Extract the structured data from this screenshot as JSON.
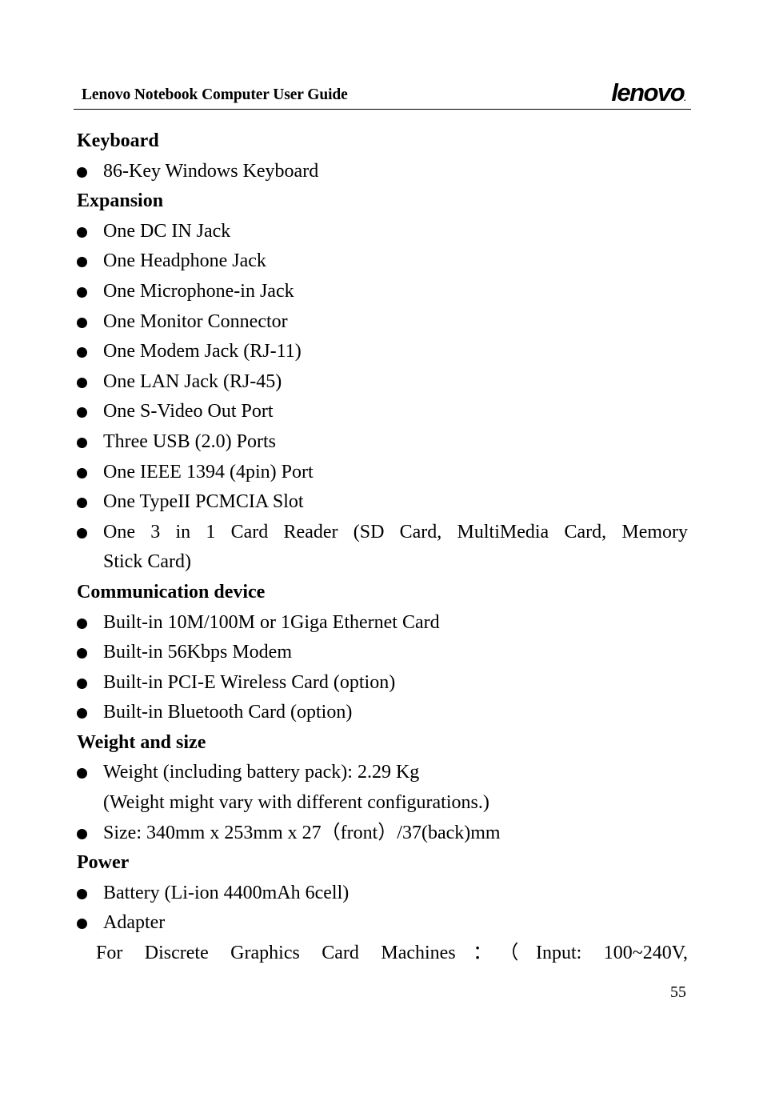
{
  "header": {
    "title": "Lenovo Notebook Computer User Guide",
    "logo_text": "lenovo",
    "logo_dot": "."
  },
  "sections": [
    {
      "heading": "Keyboard",
      "items": [
        "86-Key Windows Keyboard"
      ]
    },
    {
      "heading": "Expansion",
      "items": [
        "One DC IN Jack",
        "One Headphone Jack",
        "One Microphone-in Jack",
        "One Monitor Connector",
        "One Modem Jack (RJ-11)",
        "One LAN Jack (RJ-45)",
        "One S-Video Out Port",
        "Three USB (2.0) Ports",
        "One IEEE 1394 (4pin) Port",
        "One TypeII PCMCIA Slot"
      ],
      "wrapped_item": {
        "line1": "One 3 in 1 Card Reader (SD Card, MultiMedia Card, Memory",
        "line2": "Stick Card)"
      }
    },
    {
      "heading": "Communication device",
      "items": [
        "Built-in 10M/100M or 1Giga Ethernet Card",
        "Built-in 56Kbps Modem",
        "Built-in PCI-E Wireless Card (option)",
        "Built-in Bluetooth Card (option)"
      ]
    },
    {
      "heading": "Weight and size",
      "weight_item": "Weight (including battery pack): 2.29 Kg",
      "weight_note": "(Weight might vary with different configurations.)",
      "size_item": "Size: 340mm x 253mm x 27（front）/37(back)mm"
    },
    {
      "heading": "Power",
      "items": [
        "Battery (Li-ion 4400mAh 6cell)",
        "Adapter"
      ],
      "adapter_detail": "For Discrete Graphics Card Machines：（Input: 100~240V,"
    }
  ],
  "footer": {
    "page_number": "55"
  }
}
